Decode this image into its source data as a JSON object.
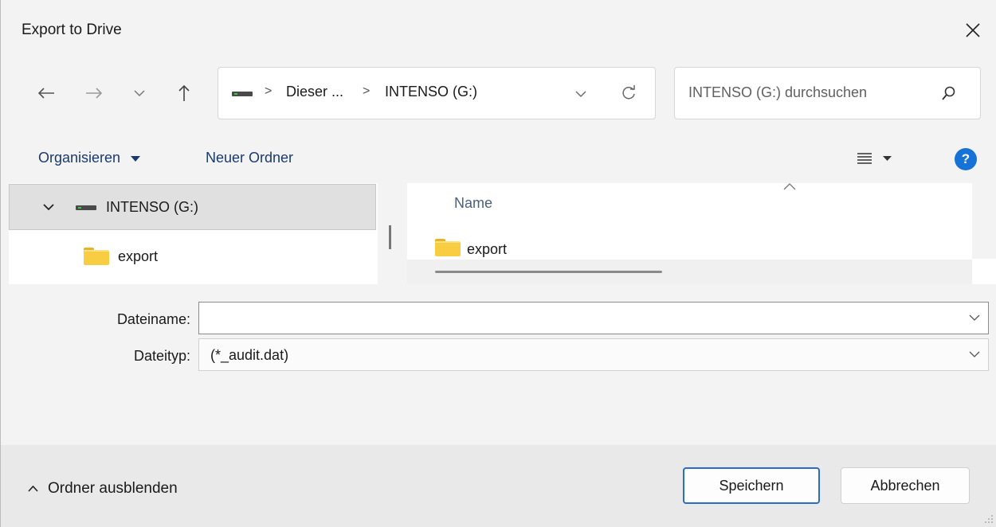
{
  "window": {
    "title": "Export to Drive"
  },
  "address": {
    "crumb1": "Dieser ...",
    "crumb2": "INTENSO (G:)",
    "sep": ">"
  },
  "search": {
    "placeholder": "INTENSO (G:) durchsuchen"
  },
  "commands": {
    "organize": "Organisieren",
    "new_folder": "Neuer Ordner"
  },
  "tree": {
    "drive": "INTENSO (G:)",
    "items": [
      {
        "label": "export"
      }
    ]
  },
  "file_list": {
    "column_name": "Name",
    "items": [
      {
        "name": "export"
      }
    ]
  },
  "form": {
    "filename_label": "Dateiname:",
    "filename_value": "",
    "filetype_label": "Dateityp:",
    "filetype_value": "(*_audit.dat)"
  },
  "footer": {
    "toggle_label": "Ordner ausblenden",
    "save_label": "Speichern",
    "cancel_label": "Abbrechen"
  },
  "colors": {
    "accent": "#1672d6",
    "primary_border": "#2b6cc4",
    "folder": "#f8cd41"
  }
}
